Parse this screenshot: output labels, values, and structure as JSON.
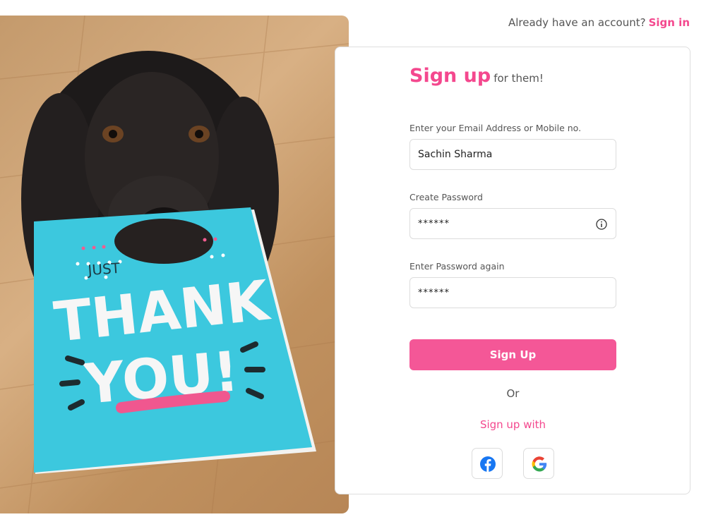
{
  "header": {
    "prompt": "Already have an account?",
    "signin_label": "Sign in"
  },
  "hero": {
    "card_top": "JUST",
    "card_line1": "THANK",
    "card_line2": "YOU!"
  },
  "form": {
    "title": "Sign up",
    "subtitle": "for them!",
    "email_label": "Enter your Email Address or Mobile no.",
    "email_value": "Sachin Sharma",
    "password_label": "Create Password",
    "password_value": "******",
    "confirm_label": "Enter Password again",
    "confirm_value": "******",
    "submit_label": "Sign Up",
    "or_text": "Or",
    "signup_with": "Sign up with"
  },
  "social": [
    "facebook-icon",
    "google-icon"
  ],
  "colors": {
    "accent": "#f4488e",
    "button": "#f45797",
    "card_blue": "#3cc8de"
  }
}
